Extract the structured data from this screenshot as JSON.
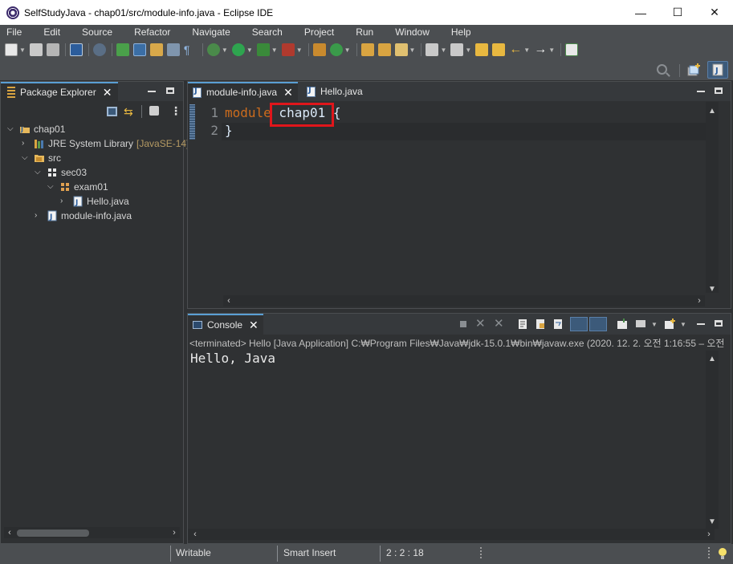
{
  "window": {
    "title": "SelfStudyJava - chap01/src/module-info.java - Eclipse IDE",
    "minimize": "—",
    "maximize": "☐",
    "close": "✕"
  },
  "menu": [
    {
      "label": "File"
    },
    {
      "label": "Edit"
    },
    {
      "label": "Source"
    },
    {
      "label": "Refactor"
    },
    {
      "label": "Navigate"
    },
    {
      "label": "Search"
    },
    {
      "label": "Project"
    },
    {
      "label": "Run"
    },
    {
      "label": "Window"
    },
    {
      "label": "Help"
    }
  ],
  "package_explorer": {
    "tab_label": "Package Explorer",
    "tree": [
      {
        "label": "chap01",
        "icon": "java-project-icon",
        "expanded": true,
        "depth": 0
      },
      {
        "label": "JRE System Library",
        "decoration": "[JavaSE-14]",
        "icon": "library-icon",
        "expanded": false,
        "depth": 1
      },
      {
        "label": "src",
        "icon": "source-folder-icon",
        "expanded": true,
        "depth": 1
      },
      {
        "label": "sec03",
        "icon": "package-icon",
        "expanded": true,
        "depth": 2
      },
      {
        "label": "exam01",
        "icon": "package-icon",
        "expanded": true,
        "depth": 3
      },
      {
        "label": "Hello.java",
        "icon": "java-file-icon",
        "expanded": false,
        "depth": 4
      },
      {
        "label": "module-info.java",
        "icon": "java-file-icon",
        "expanded": false,
        "depth": 2
      }
    ]
  },
  "editor": {
    "tabs": [
      {
        "label": "module-info.java",
        "active": true
      },
      {
        "label": "Hello.java",
        "active": false
      }
    ],
    "lines": [
      {
        "number": "1",
        "keyword": "module",
        "rest": " chap01 {"
      },
      {
        "number": "2",
        "keyword": "",
        "rest": "}"
      }
    ],
    "highlight_text": "chap01",
    "highlight_color": "#e0161b"
  },
  "console": {
    "tab_label": "Console",
    "status": "<terminated> Hello [Java Application] C:₩Program Files₩Java₩jdk-15.0.1₩bin₩javaw.exe  (2020. 12. 2. 오전 1:16:55 – 오전",
    "output": "Hello, Java"
  },
  "statusbar": {
    "writable": "Writable",
    "insert_mode": "Smart Insert",
    "position": "2 : 2 : 18"
  },
  "colors": {
    "keyword": "#cc6c1d",
    "background": "#2f3133",
    "chrome": "#4b4e51",
    "active_tab_accent": "#5a9fd4"
  }
}
